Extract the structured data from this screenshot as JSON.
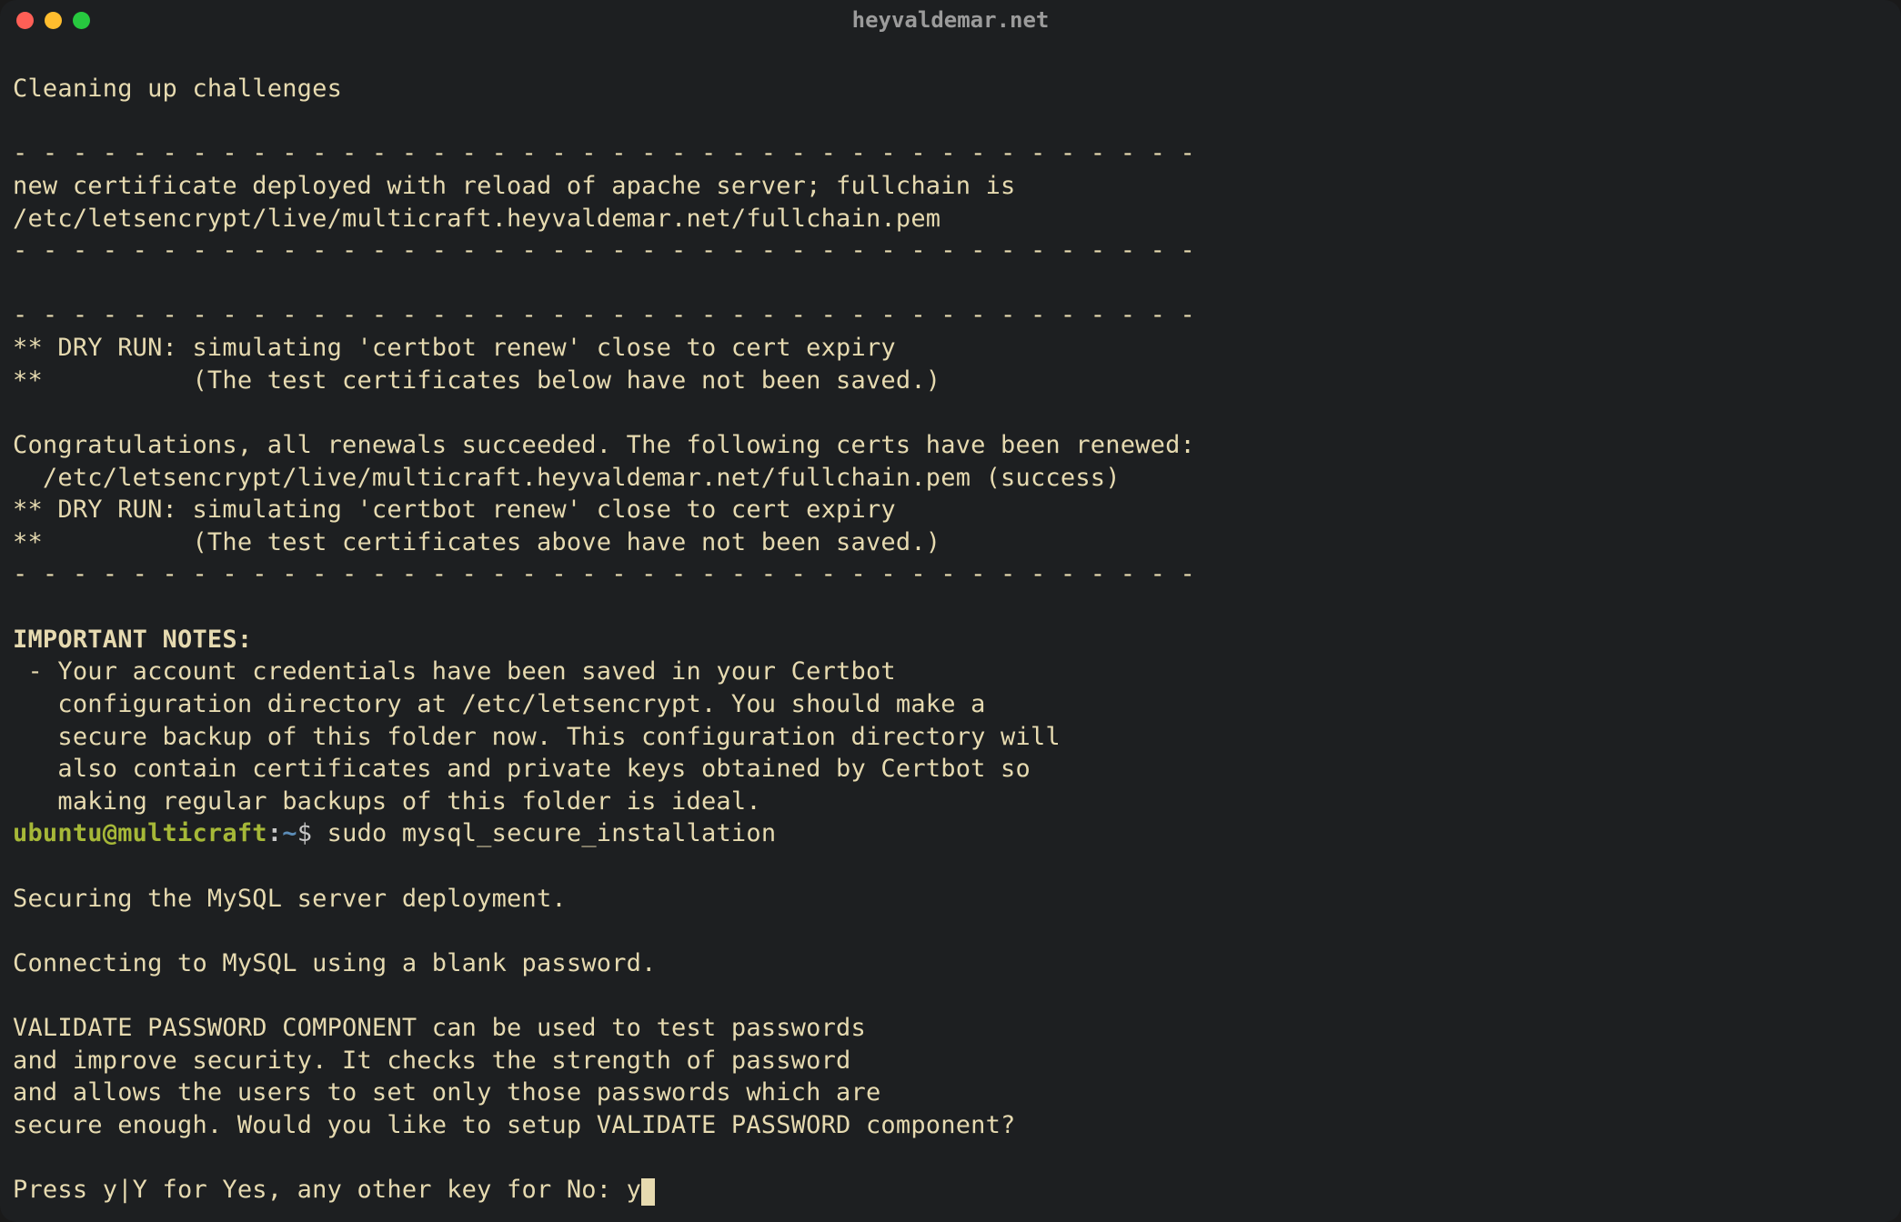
{
  "window": {
    "title": "heyvaldemar.net"
  },
  "terminal": {
    "line_cleaning": "Cleaning up challenges",
    "dash_rule": "- - - - - - - - - - - - - - - - - - - - - - - - - - - - - - - - - - - - - - - -",
    "cert_deployed_1": "new certificate deployed with reload of apache server; fullchain is",
    "cert_deployed_2": "/etc/letsencrypt/live/multicraft.heyvaldemar.net/fullchain.pem",
    "dryrun_1": "** DRY RUN: simulating 'certbot renew' close to cert expiry",
    "dryrun_2": "**          (The test certificates below have not been saved.)",
    "congrats_1": "Congratulations, all renewals succeeded. The following certs have been renewed:",
    "congrats_2": "  /etc/letsencrypt/live/multicraft.heyvaldemar.net/fullchain.pem (success)",
    "dryrun_3": "** DRY RUN: simulating 'certbot renew' close to cert expiry",
    "dryrun_4": "**          (The test certificates above have not been saved.)",
    "notes_heading": "IMPORTANT NOTES:",
    "notes_1": " - Your account credentials have been saved in your Certbot",
    "notes_2": "   configuration directory at /etc/letsencrypt. You should make a",
    "notes_3": "   secure backup of this folder now. This configuration directory will",
    "notes_4": "   also contain certificates and private keys obtained by Certbot so",
    "notes_5": "   making regular backups of this folder is ideal.",
    "prompt_user": "ubuntu@multicraft",
    "prompt_colon": ":",
    "prompt_path": "~",
    "prompt_dollar": "$ ",
    "command": "sudo mysql_secure_installation",
    "securing": "Securing the MySQL server deployment.",
    "connecting": "Connecting to MySQL using a blank password.",
    "validate_1": "VALIDATE PASSWORD COMPONENT can be used to test passwords",
    "validate_2": "and improve security. It checks the strength of password",
    "validate_3": "and allows the users to set only those passwords which are",
    "validate_4": "secure enough. Would you like to setup VALIDATE PASSWORD component?",
    "press_prompt": "Press y|Y for Yes, any other key for No: ",
    "user_input": "y"
  }
}
